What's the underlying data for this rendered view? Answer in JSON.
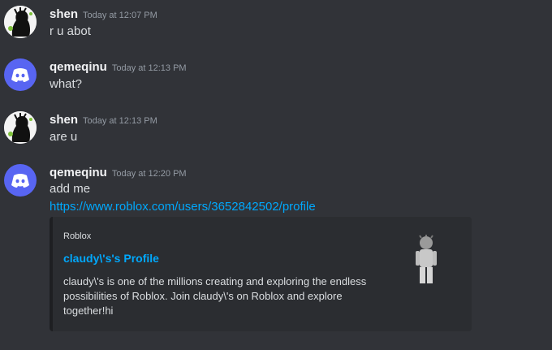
{
  "messages": [
    {
      "username": "shen",
      "timestamp": "Today at 12:07 PM",
      "text": "r u abot",
      "avatar": "shen-avatar"
    },
    {
      "username": "qemeqinu",
      "timestamp": "Today at 12:13 PM",
      "text": "what?",
      "avatar": "discord-avatar"
    },
    {
      "username": "shen",
      "timestamp": "Today at 12:13 PM",
      "text": "are u",
      "avatar": "shen-avatar"
    },
    {
      "username": "qemeqinu",
      "timestamp": "Today at 12:20 PM",
      "text": "add me",
      "link": "https://www.roblox.com/users/3652842502/profile",
      "avatar": "discord-avatar"
    }
  ],
  "embed": {
    "provider": "Roblox",
    "title": "claudy\\'s's Profile",
    "description": "claudy\\'s is one of the millions creating and exploring the endless possibilities of Roblox. Join claudy\\'s on Roblox and explore together!hi",
    "thumbnail": "roblox-avatar-thumbnail"
  },
  "colors": {
    "background": "#313338",
    "link": "#00a8fc",
    "blurple": "#5865f2",
    "embed_bg": "#2b2d31"
  }
}
